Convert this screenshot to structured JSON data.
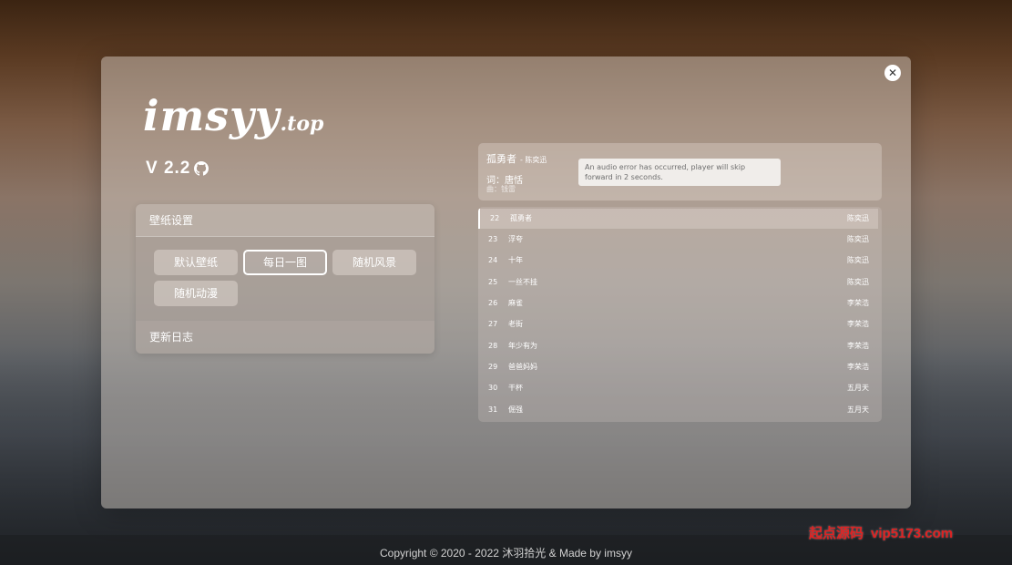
{
  "logo": {
    "main": "imsyy",
    "sub": ".top"
  },
  "version": "V 2.2",
  "wallpaper_panel": {
    "title": "壁纸设置",
    "options": [
      "默认壁纸",
      "每日一图",
      "随机风景",
      "随机动漫"
    ],
    "selected": "每日一图",
    "changelog": "更新日志"
  },
  "player": {
    "song": "孤勇者",
    "artist": "- 陈奕迅",
    "lyricist": "词：唐恬",
    "composer": "曲：钱雷",
    "error_message": "An audio error has occurred, player will skip forward in 2 seconds.",
    "tracks": [
      {
        "num": "22",
        "name": "孤勇者",
        "singer": "陈奕迅"
      },
      {
        "num": "23",
        "name": "浮夸",
        "singer": "陈奕迅"
      },
      {
        "num": "24",
        "name": "十年",
        "singer": "陈奕迅"
      },
      {
        "num": "25",
        "name": "一丝不挂",
        "singer": "陈奕迅"
      },
      {
        "num": "26",
        "name": "麻雀",
        "singer": "李荣浩"
      },
      {
        "num": "27",
        "name": "老街",
        "singer": "李荣浩"
      },
      {
        "num": "28",
        "name": "年少有为",
        "singer": "李荣浩"
      },
      {
        "num": "29",
        "name": "爸爸妈妈",
        "singer": "李荣浩"
      },
      {
        "num": "30",
        "name": "干杯",
        "singer": "五月天"
      },
      {
        "num": "31",
        "name": "倔强",
        "singer": "五月天"
      }
    ]
  },
  "footer": {
    "copyright": "Copyright © 2020 - 2022 沐羽拾光 &  Made by imsyy"
  },
  "watermark": {
    "label": "起点源码",
    "url": "vip5173.com"
  },
  "icons": {
    "close": "close-icon",
    "github": "github-icon"
  }
}
